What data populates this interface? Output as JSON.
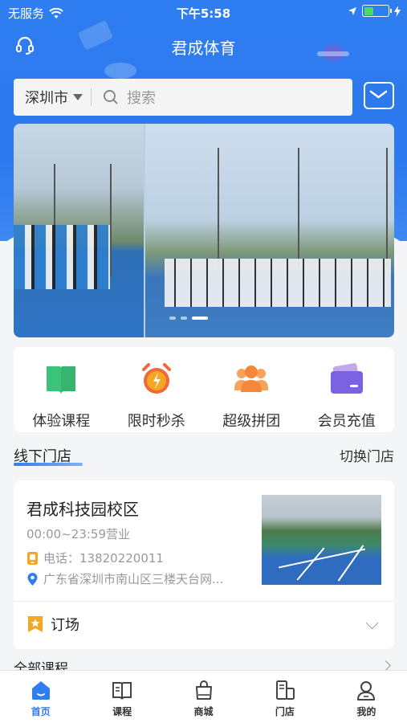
{
  "status_bar": {
    "carrier": "无服务",
    "time": "下午5:58"
  },
  "header": {
    "title": "君成体育"
  },
  "search": {
    "city": "深圳市",
    "placeholder": "搜索"
  },
  "banner": {
    "page_count": 3,
    "active_index": 2
  },
  "quick_actions": [
    {
      "label": "体验课程",
      "icon": "book-icon"
    },
    {
      "label": "限时秒杀",
      "icon": "alarm-clock-icon"
    },
    {
      "label": "超级拼团",
      "icon": "group-icon"
    },
    {
      "label": "会员充值",
      "icon": "card-icon"
    }
  ],
  "stores_section": {
    "title": "线下门店",
    "switch_label": "切换门店"
  },
  "store": {
    "name": "君成科技园校区",
    "hours": "00:00~23:59营业",
    "phone": "电话：13820220011",
    "address": "广东省深圳市南山区三楼天台网...",
    "book_label": "订场"
  },
  "courses_section": {
    "title": "全部课程"
  },
  "tabbar": [
    {
      "label": "首页",
      "icon": "home-icon",
      "active": true
    },
    {
      "label": "课程",
      "icon": "course-book-icon",
      "active": false
    },
    {
      "label": "商城",
      "icon": "shopping-bag-icon",
      "active": false
    },
    {
      "label": "门店",
      "icon": "store-icon",
      "active": false
    },
    {
      "label": "我的",
      "icon": "profile-icon",
      "active": false
    }
  ],
  "colors": {
    "primary": "#2f7ef1",
    "book_icon": "#3cc37a",
    "alarm_icon": "#f0693a",
    "group_icon": "#f5873a",
    "card_icon": "#7b62e3"
  }
}
